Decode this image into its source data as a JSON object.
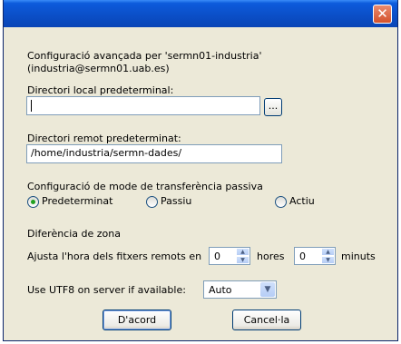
{
  "titlebar": {
    "close_glyph": "✕"
  },
  "header": {
    "line1": "Configuració avançada per 'sermn01-industria'",
    "line2": "(industria@sermn01.uab.es)"
  },
  "local_dir": {
    "label": "Directori local predeterminal:",
    "value": "",
    "browse_label": "..."
  },
  "remote_dir": {
    "label": "Directori remot predeterminat:",
    "value": "/home/industria/sermn-dades/"
  },
  "transfer_mode": {
    "label": "Configuració de mode de transferència passiva",
    "options": [
      "Predeterminat",
      "Passiu",
      "Actiu"
    ],
    "selected": "Predeterminat"
  },
  "timezone": {
    "label": "Diferència de zona",
    "adjust_label": "Ajusta l'hora dels fitxers remots en",
    "hours_value": "0",
    "hours_label": "hores",
    "minutes_value": "0",
    "minutes_label": "minuts"
  },
  "utf8": {
    "label": "Use UTF8 on server if available:",
    "value": "Auto"
  },
  "buttons": {
    "ok": "D'acord",
    "cancel": "Cancel·la"
  }
}
